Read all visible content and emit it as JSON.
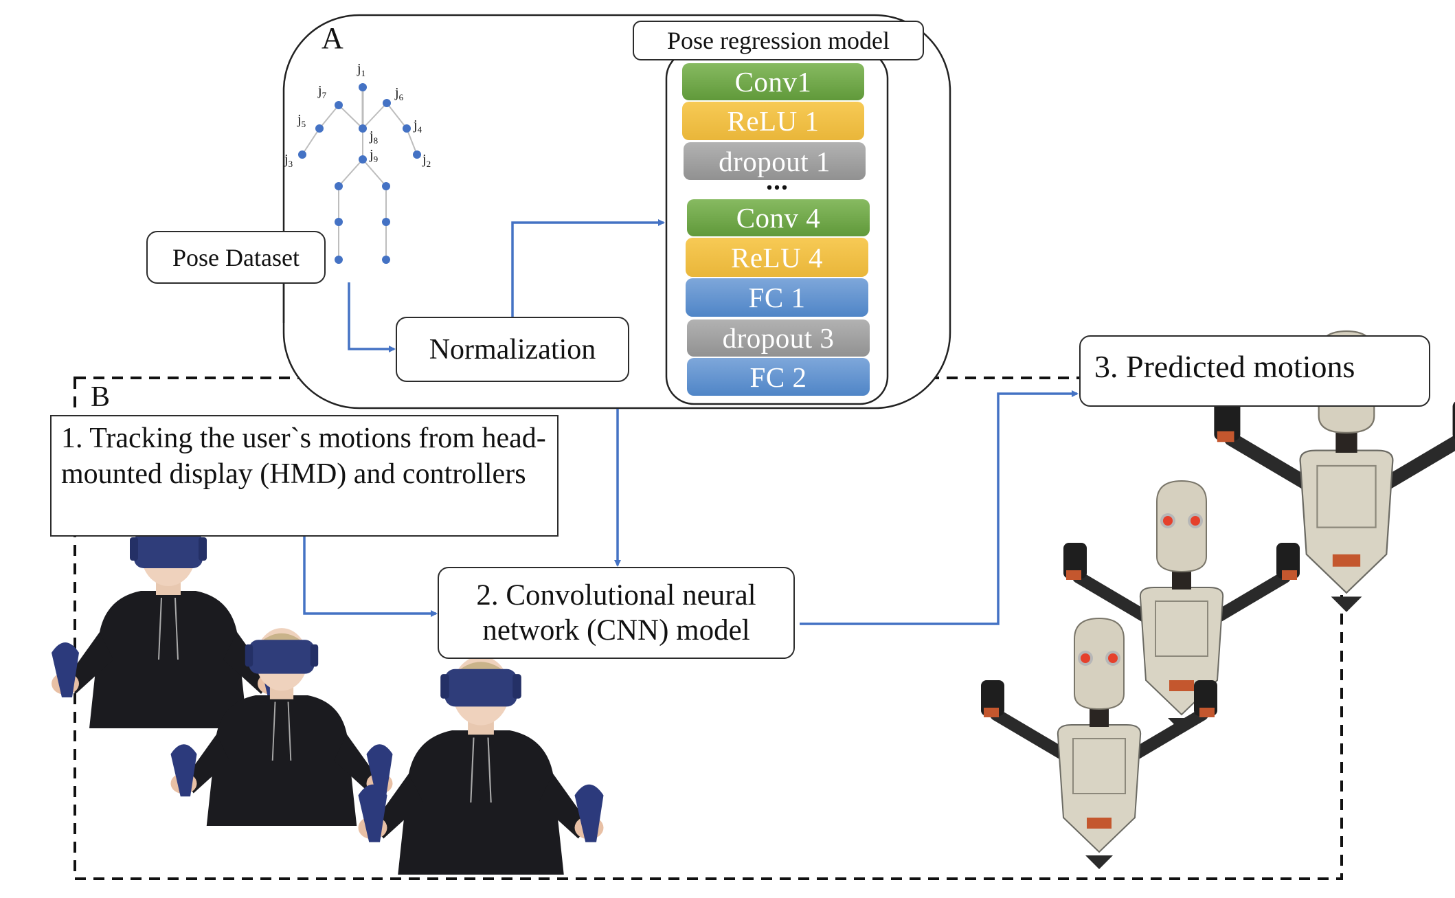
{
  "section_a": {
    "label": "A",
    "pose_dataset": "Pose Dataset",
    "normalization": "Normalization",
    "model_title": "Pose regression model",
    "skeleton_joints": [
      {
        "id": "j1",
        "sub": "1"
      },
      {
        "id": "j2",
        "sub": "2"
      },
      {
        "id": "j3",
        "sub": "3"
      },
      {
        "id": "j4",
        "sub": "4"
      },
      {
        "id": "j5",
        "sub": "5"
      },
      {
        "id": "j6",
        "sub": "6"
      },
      {
        "id": "j7",
        "sub": "7"
      },
      {
        "id": "j8",
        "sub": "8"
      },
      {
        "id": "j9",
        "sub": "9"
      }
    ],
    "layers": [
      {
        "label": "Conv1",
        "kind": "conv"
      },
      {
        "label": "ReLU 1",
        "kind": "relu"
      },
      {
        "label": "dropout 1",
        "kind": "dropout"
      },
      {
        "label": "Conv 4",
        "kind": "conv"
      },
      {
        "label": "ReLU 4",
        "kind": "relu"
      },
      {
        "label": "FC 1",
        "kind": "fc"
      },
      {
        "label": "dropout 3",
        "kind": "dropout"
      },
      {
        "label": "FC 2",
        "kind": "fc"
      }
    ],
    "ellipsis": "•••"
  },
  "section_b": {
    "label": "B",
    "step1": "1. Tracking the user`s motions from head-mounted display (HMD) and controllers",
    "step2": "2. Convolutional neural network (CNN) model",
    "step3": "3. Predicted motions",
    "user_photos": [
      "user-with-hmd-pose-1",
      "user-with-hmd-pose-2",
      "user-with-hmd-pose-3"
    ],
    "robot_avatars": [
      "robot-avatar-pose-1",
      "robot-avatar-pose-2",
      "robot-avatar-pose-3"
    ]
  },
  "colors": {
    "arrow": "#4472C4",
    "joint": "#4472C4",
    "conv": "#70AD47",
    "relu": "#F4C142",
    "dropout": "#A5A5A5",
    "fc": "#5B8FD0"
  }
}
